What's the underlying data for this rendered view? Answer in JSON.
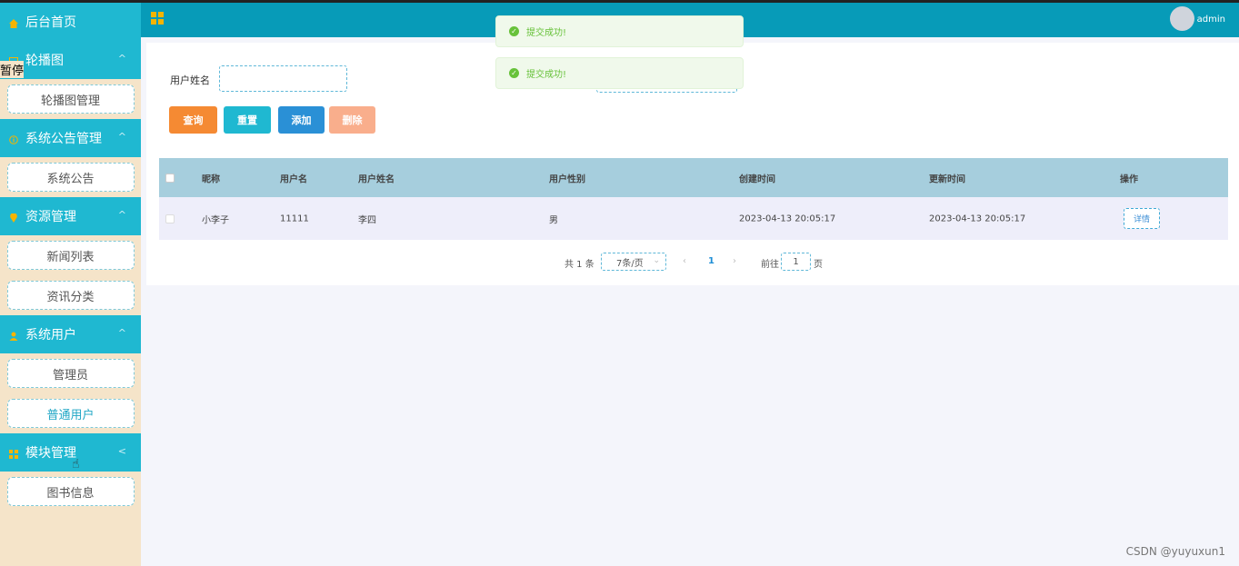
{
  "sidebar": {
    "home_label": "后台首页",
    "stray_text": "暂停",
    "groups": [
      {
        "label": "轮播图",
        "icon": "image-icon",
        "chevron": "^",
        "items": [
          "轮播图管理"
        ]
      },
      {
        "label": "系统公告管理",
        "icon": "info-icon",
        "chevron": "^",
        "items": [
          "系统公告"
        ]
      },
      {
        "label": "资源管理",
        "icon": "location-icon",
        "chevron": "^",
        "items": [
          "新闻列表",
          "资讯分类"
        ]
      },
      {
        "label": "系统用户",
        "icon": "user-icon",
        "chevron": "^",
        "items": [
          "管理员",
          "普通用户"
        ]
      },
      {
        "label": "模块管理",
        "icon": "grid-icon",
        "chevron": "<",
        "items": [
          "图书信息"
        ]
      }
    ],
    "active_item": "普通用户"
  },
  "header": {
    "menu_icon": "grid-icon",
    "username": "admin"
  },
  "toasts": [
    "提交成功!",
    "提交成功!"
  ],
  "search": {
    "label": "用户姓名",
    "value": ""
  },
  "buttons": {
    "query": "查询",
    "reset": "重置",
    "add": "添加",
    "delete": "删除"
  },
  "colors": {
    "query": "#f58a33",
    "reset": "#1fb8d1",
    "add": "#2a90d6",
    "delete": "#f9ae8c",
    "header": "#079bb8",
    "sidebar_head": "#1fb8d1"
  },
  "table": {
    "columns": [
      "昵称",
      "用户名",
      "用户姓名",
      "用户性别",
      "创建时间",
      "更新时间",
      "操作"
    ],
    "rows": [
      {
        "nickname": "小李子",
        "username": "11111",
        "realname": "李四",
        "gender": "男",
        "created": "2023-04-13 20:05:17",
        "updated": "2023-04-13 20:05:17",
        "action": "详情"
      }
    ]
  },
  "pagination": {
    "total": "共 1 条",
    "page_size": "7条/页",
    "prev": "‹",
    "current": "1",
    "next": "›",
    "goto_label": "前往",
    "goto_value": "1",
    "page_unit": "页"
  },
  "watermark": "CSDN @yuyuxun1"
}
